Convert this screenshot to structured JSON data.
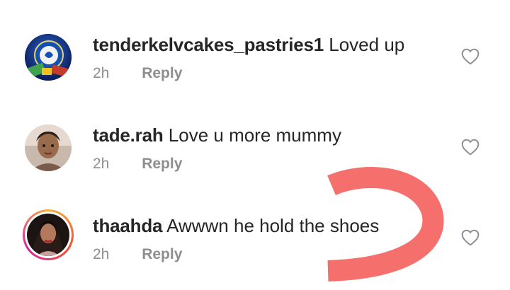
{
  "comments": [
    {
      "username": "tenderkelvcakes_pastries1",
      "text": "Loved up",
      "time": "2h",
      "reply_label": "Reply",
      "avatar_icon": "football-club-crest"
    },
    {
      "username": "tade.rah",
      "text": "Love u more mummy",
      "time": "2h",
      "reply_label": "Reply",
      "avatar_icon": "profile-photo"
    },
    {
      "username": "thaahda",
      "text": "Awwwn he hold the shoes",
      "time": "2h",
      "reply_label": "Reply",
      "avatar_icon": "profile-photo-story-ring"
    }
  ],
  "colors": {
    "username": "#262626",
    "meta": "#8e8e8e",
    "annotation": "#f5706c",
    "story_ring_start": "#f9ad3f",
    "story_ring_end": "#d6249f"
  },
  "icons": {
    "like": "heart-outline-icon"
  }
}
